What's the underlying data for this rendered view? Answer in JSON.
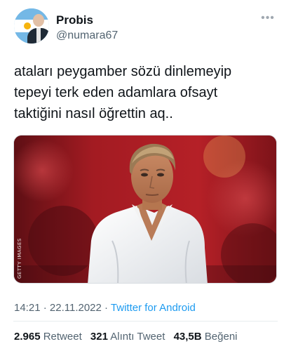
{
  "user": {
    "name": "Probis",
    "handle": "@numara67"
  },
  "more_icon": "more-horizontal-icon",
  "tweet": {
    "text": "ataları peygamber sözü dinlemeyip\ntepeyi terk eden adamlara ofsayt\ntaktiğini nasıl öğrettin aq.."
  },
  "media": {
    "watermark": "GETTY IMAGES"
  },
  "meta": {
    "time": "14:21",
    "sep1": " · ",
    "date": "22.11.2022",
    "sep2": " · ",
    "source": "Twitter for Android"
  },
  "stats": {
    "retweets_count": "2.965",
    "retweets_label": "Retweet",
    "quotes_count": "321",
    "quotes_label": "Alıntı Tweet",
    "likes_count": "43,5B",
    "likes_label": "Beğeni"
  },
  "colors": {
    "link_blue": "#1d9bf0",
    "secondary_text": "#536471",
    "primary_text": "#0f1419"
  }
}
